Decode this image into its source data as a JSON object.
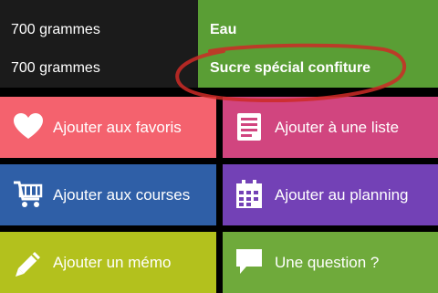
{
  "ingredients": [
    {
      "quantity": "700 grammes",
      "name": "Eau"
    },
    {
      "quantity": "700 grammes",
      "name": "Sucre spécial confiture"
    }
  ],
  "actions": [
    {
      "label": "Ajouter aux favoris",
      "icon": "heart-icon",
      "color": "#f4626e"
    },
    {
      "label": "Ajouter à une liste",
      "icon": "list-icon",
      "color": "#d1457f"
    },
    {
      "label": "Ajouter aux courses",
      "icon": "cart-icon",
      "color": "#2f5fa7"
    },
    {
      "label": "Ajouter au planning",
      "icon": "calendar-icon",
      "color": "#7341b6"
    },
    {
      "label": "Ajouter un mémo",
      "icon": "pencil-icon",
      "color": "#b3c11d"
    },
    {
      "label": "Une question ?",
      "icon": "speech-bubble-icon",
      "color": "#6faa3b"
    }
  ],
  "colors": {
    "quantity_bg": "#1b1b1b",
    "ingredient_bg": "#5a9e35",
    "annotation_stroke": "#cc2a26"
  }
}
